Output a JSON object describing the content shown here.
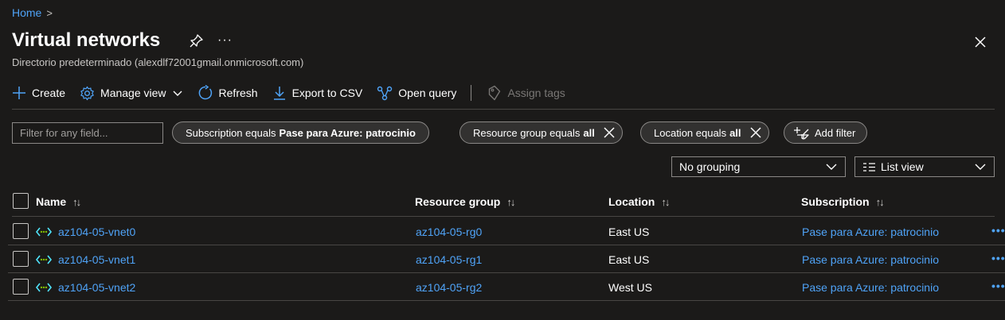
{
  "breadcrumb": {
    "home": "Home",
    "chevron": ">"
  },
  "header": {
    "title": "Virtual networks",
    "more": "···",
    "subtitle": "Directorio predeterminado (alexdlf72001gmail.onmicrosoft.com)"
  },
  "toolbar": {
    "create": "Create",
    "manage_view": "Manage view",
    "refresh": "Refresh",
    "export_csv": "Export to CSV",
    "open_query": "Open query",
    "assign_tags": "Assign tags"
  },
  "filters": {
    "placeholder": "Filter for any field...",
    "subscription": {
      "label": "Subscription equals",
      "value": "Pase para Azure: patrocinio"
    },
    "resource_group": {
      "label": "Resource group equals",
      "value": "all"
    },
    "location": {
      "label": "Location equals",
      "value": "all"
    },
    "add_filter": "Add filter"
  },
  "view": {
    "grouping": "No grouping",
    "list_view": "List view"
  },
  "table": {
    "columns": {
      "name": "Name",
      "resource_group": "Resource group",
      "location": "Location",
      "subscription": "Subscription"
    },
    "rows": [
      {
        "name": "az104-05-vnet0",
        "resource_group": "az104-05-rg0",
        "location": "East US",
        "subscription": "Pase para Azure: patrocinio"
      },
      {
        "name": "az104-05-vnet1",
        "resource_group": "az104-05-rg1",
        "location": "East US",
        "subscription": "Pase para Azure: patrocinio"
      },
      {
        "name": "az104-05-vnet2",
        "resource_group": "az104-05-rg2",
        "location": "West US",
        "subscription": "Pase para Azure: patrocinio"
      }
    ],
    "row_more": "•••"
  },
  "colors": {
    "background": "#1b1a19",
    "link": "#4fa3f7",
    "border": "#8a8886",
    "vnet_icon": "#50e6ff"
  }
}
